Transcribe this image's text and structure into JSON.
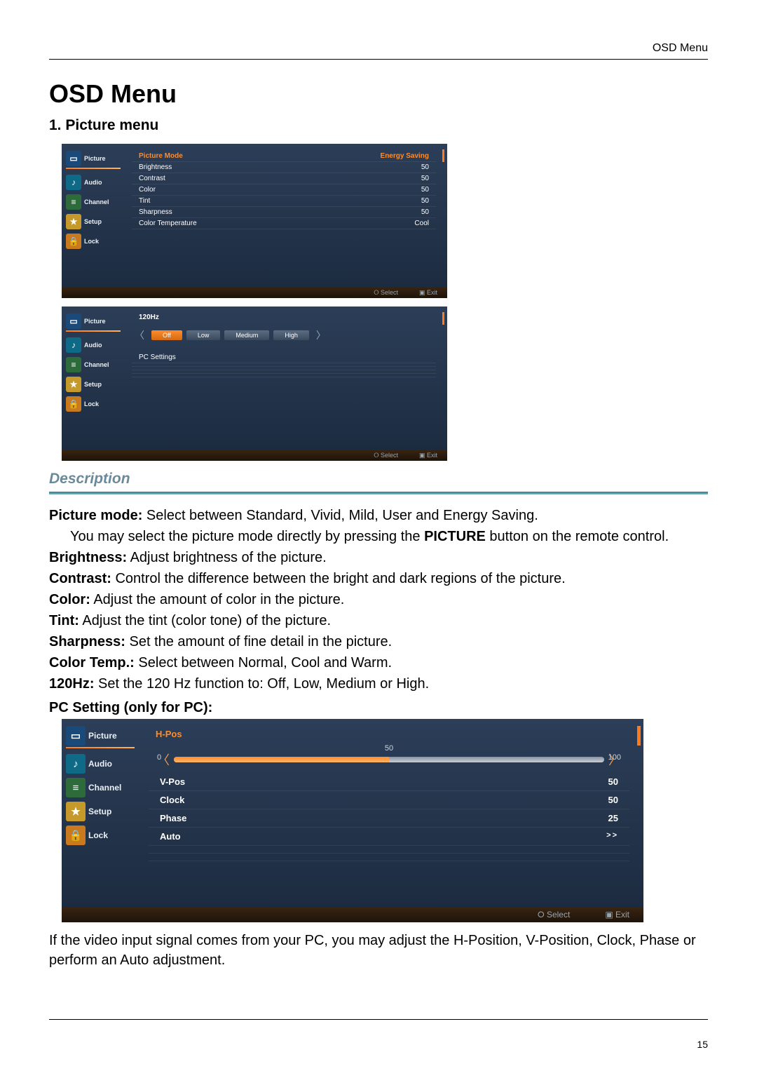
{
  "header": {
    "right": "OSD Menu"
  },
  "title": "OSD Menu",
  "section": "1. Picture menu",
  "pageNumber": "15",
  "sidebar": {
    "items": [
      "Picture",
      "Audio",
      "Channel",
      "Setup",
      "Lock"
    ]
  },
  "panel1": {
    "rows": [
      {
        "label": "Picture Mode",
        "value": "Energy Saving",
        "sel": true
      },
      {
        "label": "Brightness",
        "value": "50"
      },
      {
        "label": "Contrast",
        "value": "50"
      },
      {
        "label": "Color",
        "value": "50"
      },
      {
        "label": "Tint",
        "value": "50"
      },
      {
        "label": "Sharpness",
        "value": "50"
      },
      {
        "label": "Color Temperature",
        "value": "Cool"
      }
    ],
    "footer": {
      "select": "Select",
      "exit": "Exit"
    }
  },
  "panel2": {
    "title": "120Hz",
    "options": [
      "Off",
      "Low",
      "Medium",
      "High"
    ],
    "pcSettings": "PC Settings",
    "footer": {
      "select": "Select",
      "exit": "Exit"
    }
  },
  "panel3": {
    "title": "H-Pos",
    "slider": {
      "min": "0",
      "value": "50",
      "max": "100"
    },
    "rows": [
      {
        "label": "V-Pos",
        "value": "50"
      },
      {
        "label": "Clock",
        "value": "50"
      },
      {
        "label": "Phase",
        "value": "25"
      },
      {
        "label": "Auto",
        "value": ">>"
      }
    ],
    "footer": {
      "select": "Select",
      "exit": "Exit"
    }
  },
  "description": {
    "heading": "Description",
    "pcHeading": "PC Setting (only for PC):",
    "lines": {
      "pictureMode": {
        "label": "Picture mode:",
        "text": " Select between Standard, Vivid, Mild, User and Energy Saving."
      },
      "pictureModeNote": "You may select the picture mode directly by pressing the ",
      "pictureKey": "PICTURE",
      "pictureModeNote2": " button on the remote control.",
      "brightness": {
        "label": "Brightness:",
        "text": " Adjust brightness of the picture."
      },
      "contrast": {
        "label": "Contrast:",
        "text": " Control the difference between the bright and dark regions of the picture."
      },
      "color": {
        "label": "Color:",
        "text": " Adjust the amount of color in the picture."
      },
      "tint": {
        "label": "Tint:",
        "text": " Adjust the tint (color tone) of the picture."
      },
      "sharpness": {
        "label": "Sharpness:",
        "text": " Set the amount of fine detail in the picture."
      },
      "colorTemp": {
        "label": "Color Temp.:",
        "text": " Select between Normal, Cool and Warm."
      },
      "hz": {
        "label": "120Hz:",
        "text": " Set the 120 Hz function to: Off, Low, Medium or High."
      }
    },
    "pcNote": "If the video input signal comes from your PC, you may adjust the H-Position, V-Position, Clock, Phase or perform an Auto adjustment."
  }
}
